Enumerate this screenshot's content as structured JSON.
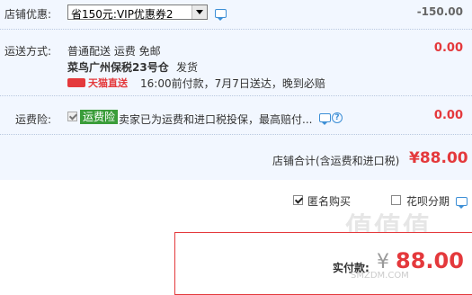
{
  "discount": {
    "label": "店铺优惠:",
    "selected": "省150元:VIP优惠券2",
    "amount": "-150.00"
  },
  "shipping": {
    "label": "运送方式:",
    "method": "普通配送 运费 免邮",
    "warehouse": "菜鸟广州保税23号仓",
    "dispatch": "发货",
    "tmall_label": "天猫直送",
    "delivery_note": "16:00前付款，7月7日送达，晚到必赔",
    "amount": "0.00"
  },
  "freight_insurance": {
    "label": "运费险:",
    "badge": "运费险",
    "text": "卖家已为运费和进口税投保，最高赔付...",
    "amount": "0.00"
  },
  "store_total": {
    "label": "店铺合计(含运费和进口税)",
    "amount": "¥88.00"
  },
  "options": {
    "anonymous_label": "匿名购买",
    "anonymous_checked": true,
    "huabei_label": "花呗分期",
    "huabei_checked": false
  },
  "payment": {
    "label": "实付款:",
    "currency": "¥",
    "amount": "88.00"
  },
  "watermark": {
    "text": "值值值",
    "site": "SMZDM.COM"
  },
  "colors": {
    "accent": "#e4393c",
    "panel_bg": "#f2f7ff",
    "badge_green": "#3a9d3a",
    "link_blue": "#3d8fd6"
  }
}
